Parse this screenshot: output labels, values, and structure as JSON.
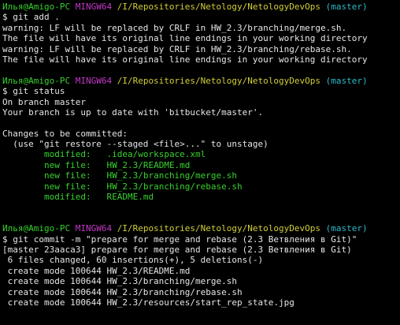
{
  "prompt": {
    "user_host": "Илья@Amigo-PC",
    "shell": "MINGW64",
    "path": "/I/Repositories/Netology/NetologyDevOps",
    "branch": "(master)",
    "symbol": "$"
  },
  "commands": {
    "add": "git add .",
    "status": "git status",
    "commit": "git commit -m \"prepare for merge and rebase (2.3 Ветвления в Git)\""
  },
  "add_output": [
    "warning: LF will be replaced by CRLF in HW_2.3/branching/merge.sh.",
    "The file will have its original line endings in your working directory",
    "warning: LF will be replaced by CRLF in HW_2.3/branching/rebase.sh.",
    "The file will have its original line endings in your working directory"
  ],
  "status_output": {
    "on_branch": "On branch master",
    "up_to_date": "Your branch is up to date with 'bitbucket/master'.",
    "changes_header": "Changes to be committed:",
    "hint": "  (use \"git restore --staged <file>...\" to unstage)",
    "changes": [
      {
        "kind": "modified:",
        "file": ".idea/workspace.xml"
      },
      {
        "kind": "new file:",
        "file": "HW_2.3/README.md"
      },
      {
        "kind": "new file:",
        "file": "HW_2.3/branching/merge.sh"
      },
      {
        "kind": "new file:",
        "file": "HW_2.3/branching/rebase.sh"
      },
      {
        "kind": "modified:",
        "file": "README.md"
      }
    ]
  },
  "commit_output": [
    "[master 23aaca3] prepare for merge and rebase (2.3 Ветвления в Git)",
    " 6 files changed, 60 insertions(+), 5 deletions(-)",
    " create mode 100644 HW_2.3/README.md",
    " create mode 100644 HW_2.3/branching/merge.sh",
    " create mode 100644 HW_2.3/branching/rebase.sh",
    " create mode 100644 HW_2.3/resources/start_rep_state.jpg"
  ],
  "colors": {
    "background": "#000000",
    "user": "#39d12f",
    "shell": "#c338c6",
    "path": "#d1cf38",
    "branch": "#2fb9c9",
    "text": "#e6e6e6"
  }
}
